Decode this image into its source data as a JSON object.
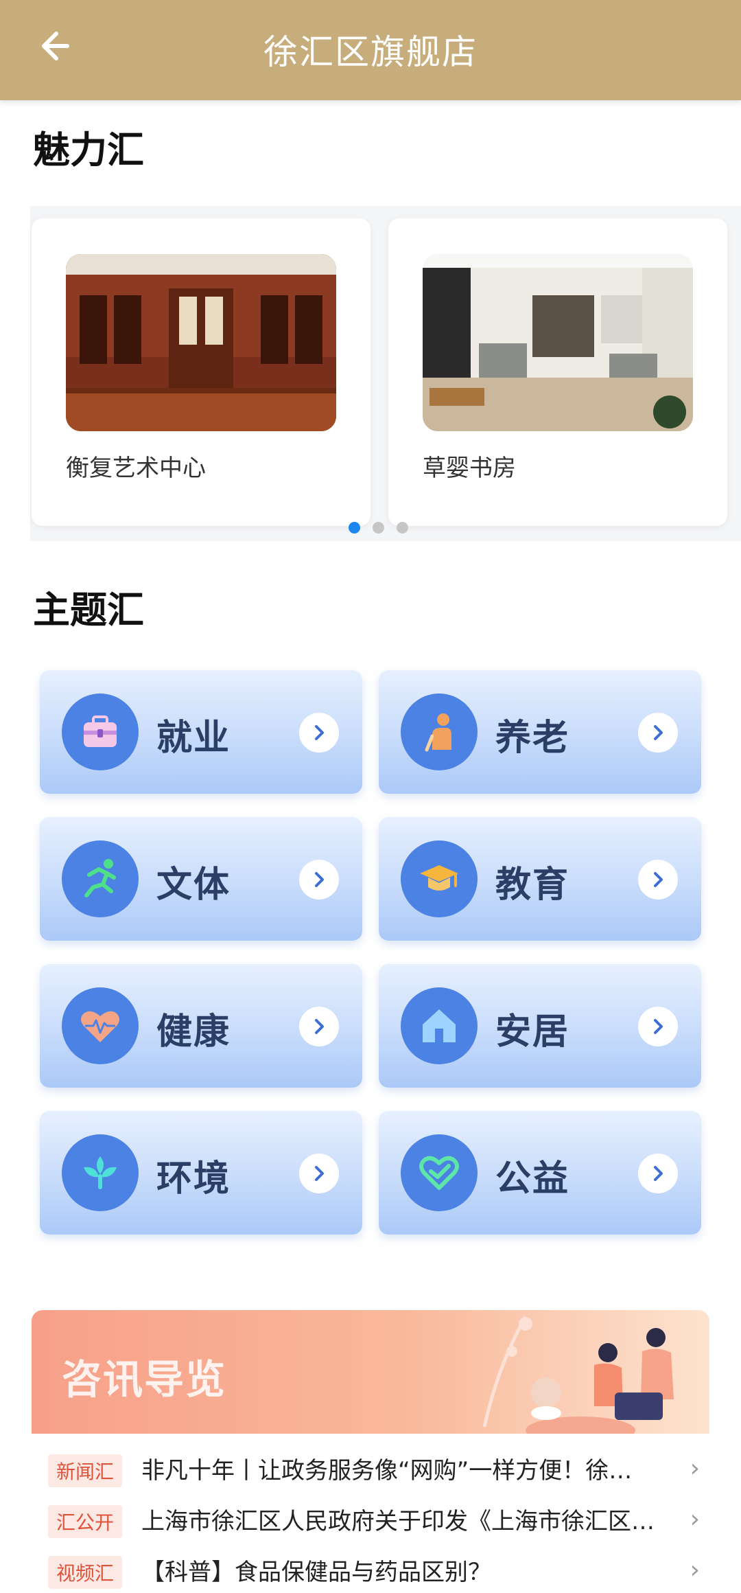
{
  "header": {
    "title": "徐汇区旗舰店",
    "back_icon": "back-arrow-icon"
  },
  "charm": {
    "title": "魅力汇",
    "cards": [
      {
        "name": "衡复艺术中心",
        "image": "wood-paneled-room"
      },
      {
        "name": "草婴书房",
        "image": "gallery-room"
      }
    ],
    "dots": {
      "count": 3,
      "active_index": 0
    }
  },
  "theme": {
    "title": "主题汇",
    "tiles": [
      {
        "label": "就业",
        "icon": "briefcase-icon"
      },
      {
        "label": "养老",
        "icon": "elderly-icon"
      },
      {
        "label": "文体",
        "icon": "running-icon"
      },
      {
        "label": "教育",
        "icon": "graduation-cap-icon"
      },
      {
        "label": "健康",
        "icon": "heart-pulse-icon"
      },
      {
        "label": "安居",
        "icon": "house-icon"
      },
      {
        "label": "环境",
        "icon": "leaf-icon"
      },
      {
        "label": "公益",
        "icon": "charity-heart-icon"
      }
    ]
  },
  "info": {
    "title": "咨讯导览",
    "news": [
      {
        "tag": "新闻汇",
        "text": "非凡十年丨让政务服务像“网购”一样方便！徐…"
      },
      {
        "tag": "汇公开",
        "text": "上海市徐汇区人民政府关于印发《上海市徐汇区…"
      },
      {
        "tag": "视频汇",
        "text": "【科普】食品保健品与药品区别？"
      }
    ]
  },
  "colors": {
    "header": "#c7ad7c",
    "accent_blue": "#4b82e3",
    "dot_active": "#1c86f0"
  }
}
